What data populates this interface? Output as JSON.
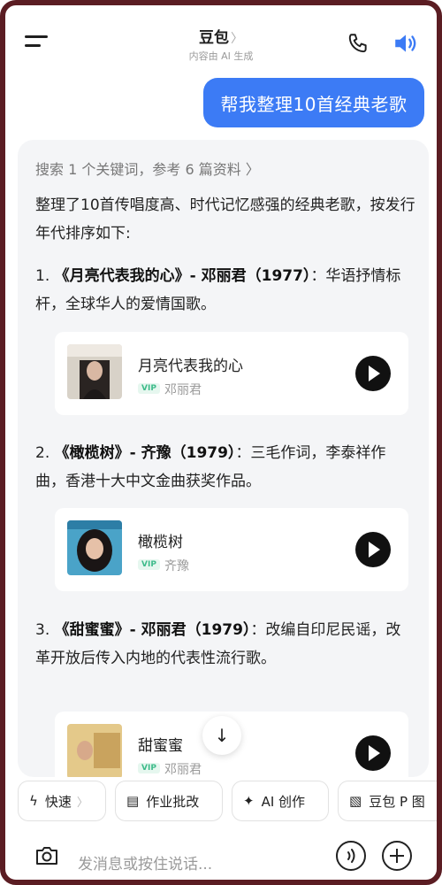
{
  "header": {
    "title": "豆包",
    "title_chevron": "〉",
    "subtitle": "内容由 AI 生成",
    "icons": [
      "menu-icon",
      "phone-icon",
      "speaker-icon"
    ]
  },
  "user_message": "帮我整理10首经典老歌",
  "answer": {
    "search_ref": "搜索 1 个关键词，参考 6 篇资料 〉",
    "intro": "整理了10首传唱度高、时代记忆感强的经典老歌，按发行年代排序如下:",
    "songs": [
      {
        "heading_num": "1.",
        "heading_title": "《月亮代表我的心》- 邓丽君（1977）",
        "heading_desc": "：华语抒情标杆，全球华人的爱情国歌。",
        "card_name": "月亮代表我的心",
        "card_artist": "邓丽君",
        "vip": "VIP"
      },
      {
        "heading_num": "2.",
        "heading_title": "《橄榄树》- 齐豫（1979）",
        "heading_desc": "：三毛作词，李泰祥作曲，香港十大中文金曲获奖作品。",
        "card_name": "橄榄树",
        "card_artist": "齐豫",
        "vip": "VIP"
      },
      {
        "heading_num": "3.",
        "heading_title": "《甜蜜蜜》- 邓丽君（1979）",
        "heading_desc": "：改编自印尼民谣，改革开放后传入内地的代表性流行歌。",
        "card_name": "甜蜜蜜",
        "card_artist": "邓丽君",
        "vip": "VIP"
      }
    ]
  },
  "shortcuts": [
    {
      "label": "快速",
      "icon": "lightning-icon",
      "chevron": "〉"
    },
    {
      "label": "作业批改",
      "icon": "homework-icon"
    },
    {
      "label": "AI 创作",
      "icon": "sparkle-icon"
    },
    {
      "label": "豆包 P 图",
      "icon": "image-edit-icon"
    }
  ],
  "input": {
    "placeholder": "发消息或按住说话..."
  },
  "colors": {
    "accent": "#3c7bf5",
    "vip_green": "#3dbb8a",
    "card_bg": "#f4f5f7"
  }
}
